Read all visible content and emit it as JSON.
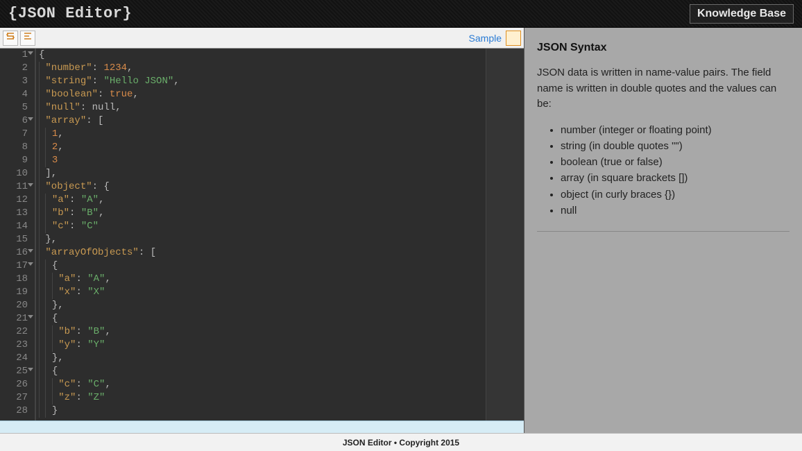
{
  "header": {
    "logo": "{JSON Editor}",
    "kb_button": "Knowledge Base"
  },
  "toolbar": {
    "sample_link": "Sample"
  },
  "kb": {
    "title": "JSON Syntax",
    "desc": "JSON data is written in name-value pairs. The field name is written in double quotes and the values can be:",
    "items": [
      "number (integer or floating point)",
      "string (in double quotes \"\")",
      "boolean (true or false)",
      "array (in square brackets [])",
      "object (in curly braces {})",
      "null"
    ]
  },
  "footer": {
    "text": "JSON Editor • Copyright 2015"
  },
  "editor": {
    "lines": [
      {
        "n": 1,
        "fold": true,
        "tokens": [
          [
            "punc",
            "{"
          ]
        ]
      },
      {
        "n": 2,
        "tokens": [
          [
            "indent",
            1
          ],
          [
            "key",
            "\"number\""
          ],
          [
            "punc",
            ": "
          ],
          [
            "num",
            "1234"
          ],
          [
            "punc",
            ","
          ]
        ]
      },
      {
        "n": 3,
        "tokens": [
          [
            "indent",
            1
          ],
          [
            "key",
            "\"string\""
          ],
          [
            "punc",
            ": "
          ],
          [
            "str",
            "\"Hello JSON\""
          ],
          [
            "punc",
            ","
          ]
        ]
      },
      {
        "n": 4,
        "tokens": [
          [
            "indent",
            1
          ],
          [
            "key",
            "\"boolean\""
          ],
          [
            "punc",
            ": "
          ],
          [
            "bool",
            "true"
          ],
          [
            "punc",
            ","
          ]
        ]
      },
      {
        "n": 5,
        "tokens": [
          [
            "indent",
            1
          ],
          [
            "key",
            "\"null\""
          ],
          [
            "punc",
            ": "
          ],
          [
            "null",
            "null"
          ],
          [
            "punc",
            ","
          ]
        ]
      },
      {
        "n": 6,
        "fold": true,
        "tokens": [
          [
            "indent",
            1
          ],
          [
            "key",
            "\"array\""
          ],
          [
            "punc",
            ": ["
          ]
        ]
      },
      {
        "n": 7,
        "tokens": [
          [
            "indent",
            2
          ],
          [
            "num",
            "1"
          ],
          [
            "punc",
            ","
          ]
        ]
      },
      {
        "n": 8,
        "tokens": [
          [
            "indent",
            2
          ],
          [
            "num",
            "2"
          ],
          [
            "punc",
            ","
          ]
        ]
      },
      {
        "n": 9,
        "tokens": [
          [
            "indent",
            2
          ],
          [
            "num",
            "3"
          ]
        ]
      },
      {
        "n": 10,
        "tokens": [
          [
            "indent",
            1
          ],
          [
            "punc",
            "],"
          ]
        ]
      },
      {
        "n": 11,
        "fold": true,
        "tokens": [
          [
            "indent",
            1
          ],
          [
            "key",
            "\"object\""
          ],
          [
            "punc",
            ": {"
          ]
        ]
      },
      {
        "n": 12,
        "tokens": [
          [
            "indent",
            2
          ],
          [
            "key",
            "\"a\""
          ],
          [
            "punc",
            ": "
          ],
          [
            "str",
            "\"A\""
          ],
          [
            "punc",
            ","
          ]
        ]
      },
      {
        "n": 13,
        "tokens": [
          [
            "indent",
            2
          ],
          [
            "key",
            "\"b\""
          ],
          [
            "punc",
            ": "
          ],
          [
            "str",
            "\"B\""
          ],
          [
            "punc",
            ","
          ]
        ]
      },
      {
        "n": 14,
        "tokens": [
          [
            "indent",
            2
          ],
          [
            "key",
            "\"c\""
          ],
          [
            "punc",
            ": "
          ],
          [
            "str",
            "\"C\""
          ]
        ]
      },
      {
        "n": 15,
        "tokens": [
          [
            "indent",
            1
          ],
          [
            "punc",
            "},"
          ]
        ]
      },
      {
        "n": 16,
        "fold": true,
        "tokens": [
          [
            "indent",
            1
          ],
          [
            "key",
            "\"arrayOfObjects\""
          ],
          [
            "punc",
            ": ["
          ]
        ]
      },
      {
        "n": 17,
        "fold": true,
        "tokens": [
          [
            "indent",
            2
          ],
          [
            "punc",
            "{"
          ]
        ]
      },
      {
        "n": 18,
        "tokens": [
          [
            "indent",
            3
          ],
          [
            "key",
            "\"a\""
          ],
          [
            "punc",
            ": "
          ],
          [
            "str",
            "\"A\""
          ],
          [
            "punc",
            ","
          ]
        ]
      },
      {
        "n": 19,
        "tokens": [
          [
            "indent",
            3
          ],
          [
            "key",
            "\"x\""
          ],
          [
            "punc",
            ": "
          ],
          [
            "str",
            "\"X\""
          ]
        ]
      },
      {
        "n": 20,
        "tokens": [
          [
            "indent",
            2
          ],
          [
            "punc",
            "},"
          ]
        ]
      },
      {
        "n": 21,
        "fold": true,
        "tokens": [
          [
            "indent",
            2
          ],
          [
            "punc",
            "{"
          ]
        ]
      },
      {
        "n": 22,
        "tokens": [
          [
            "indent",
            3
          ],
          [
            "key",
            "\"b\""
          ],
          [
            "punc",
            ": "
          ],
          [
            "str",
            "\"B\""
          ],
          [
            "punc",
            ","
          ]
        ]
      },
      {
        "n": 23,
        "tokens": [
          [
            "indent",
            3
          ],
          [
            "key",
            "\"y\""
          ],
          [
            "punc",
            ": "
          ],
          [
            "str",
            "\"Y\""
          ]
        ]
      },
      {
        "n": 24,
        "tokens": [
          [
            "indent",
            2
          ],
          [
            "punc",
            "},"
          ]
        ]
      },
      {
        "n": 25,
        "fold": true,
        "tokens": [
          [
            "indent",
            2
          ],
          [
            "punc",
            "{"
          ]
        ]
      },
      {
        "n": 26,
        "tokens": [
          [
            "indent",
            3
          ],
          [
            "key",
            "\"c\""
          ],
          [
            "punc",
            ": "
          ],
          [
            "str",
            "\"C\""
          ],
          [
            "punc",
            ","
          ]
        ]
      },
      {
        "n": 27,
        "tokens": [
          [
            "indent",
            3
          ],
          [
            "key",
            "\"z\""
          ],
          [
            "punc",
            ": "
          ],
          [
            "str",
            "\"Z\""
          ]
        ]
      },
      {
        "n": 28,
        "tokens": [
          [
            "indent",
            2
          ],
          [
            "punc",
            "}"
          ]
        ]
      }
    ]
  }
}
